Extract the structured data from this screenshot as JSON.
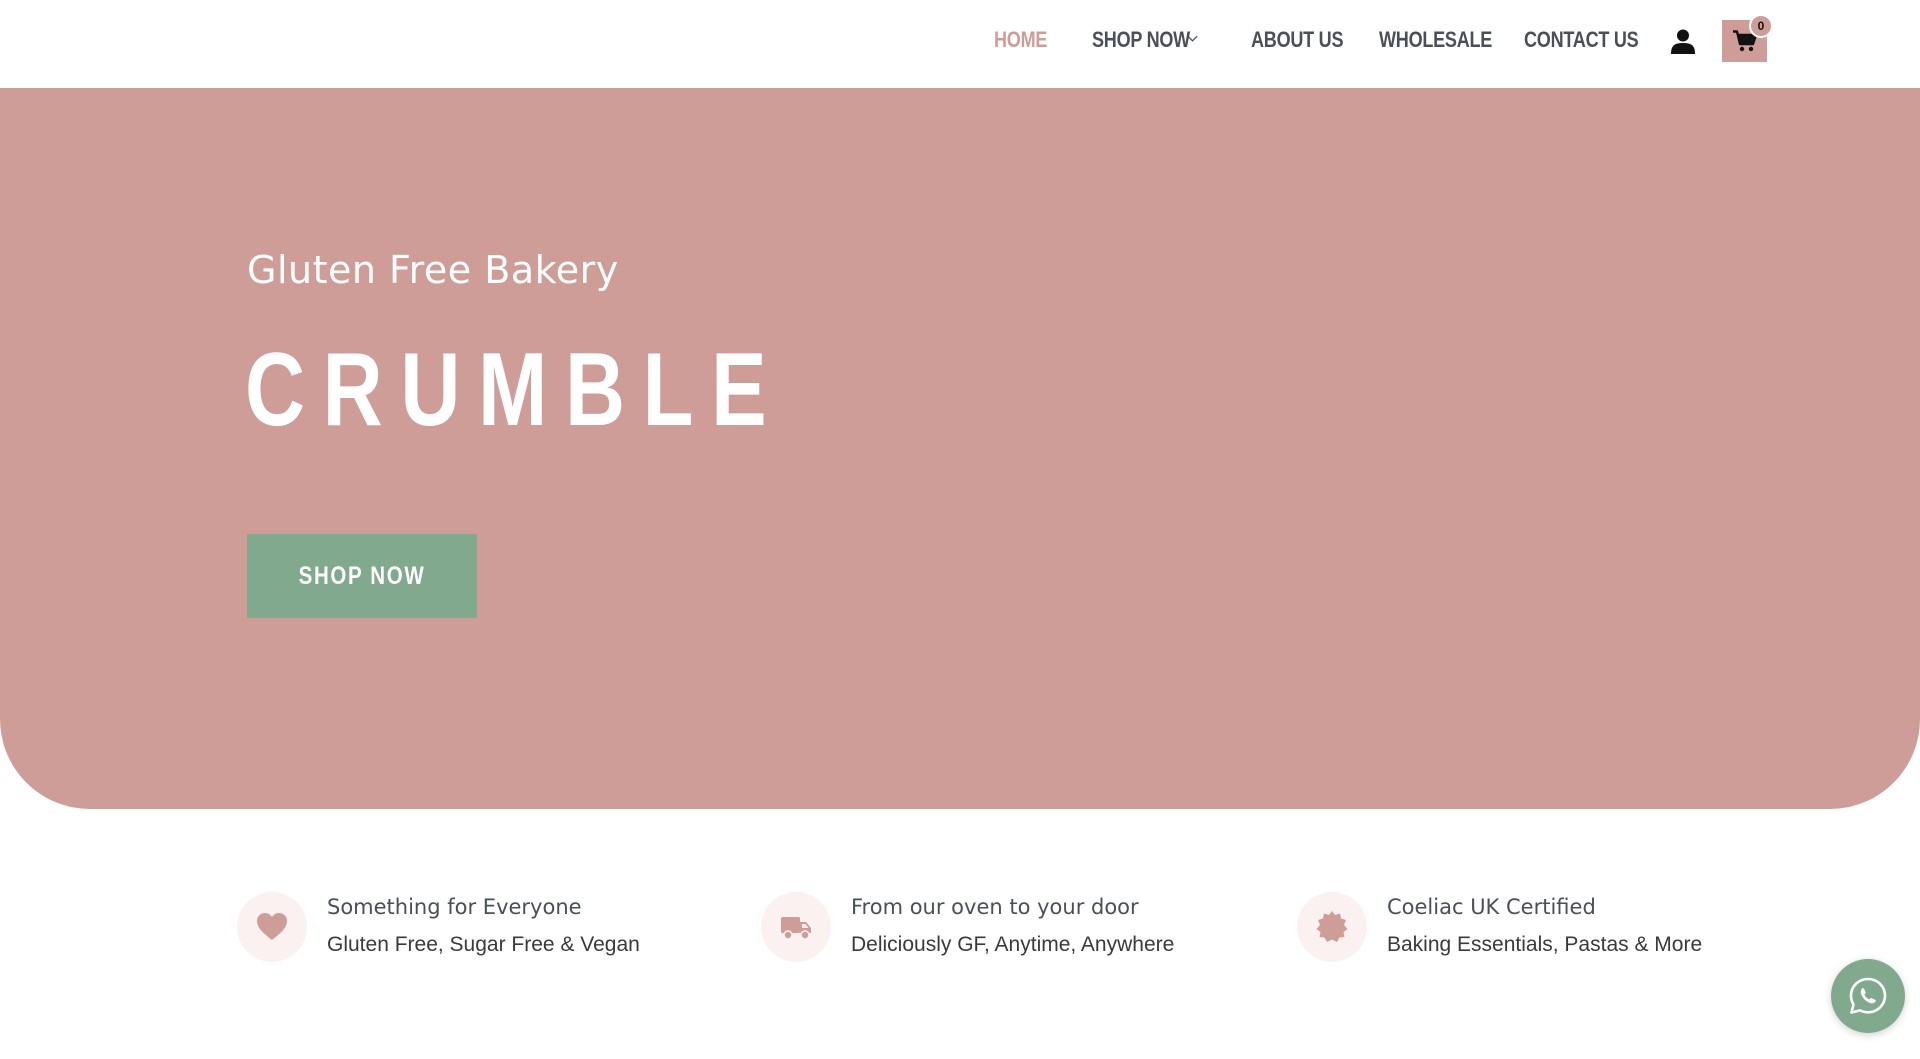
{
  "nav": {
    "items": [
      {
        "label": "HOME",
        "active": true
      },
      {
        "label": "SHOP NOW",
        "active": false,
        "dropdown": true
      },
      {
        "label": "ABOUT US",
        "active": false
      },
      {
        "label": "WHOLESALE",
        "active": false
      },
      {
        "label": "CONTACT US",
        "active": false
      }
    ],
    "icons": [
      "chevron-down-icon",
      "user-icon",
      "cart-icon"
    ],
    "cart_count": "0"
  },
  "hero": {
    "subtitle": "Gluten Free Bakery",
    "title": "CRUMBLE",
    "button_label": "SHOP NOW"
  },
  "features": [
    {
      "icon": "heart-icon",
      "title": "Something for Everyone",
      "description": "Gluten Free, Sugar Free & Vegan"
    },
    {
      "icon": "truck-icon",
      "title": "From our oven to your door",
      "description": "Deliciously GF, Anytime, Anywhere"
    },
    {
      "icon": "badge-icon",
      "title": "Coeliac UK Certified",
      "description": "Baking Essentials, Pastas & More"
    }
  ],
  "whatsapp": {
    "icon": "whatsapp-icon"
  },
  "colors": {
    "brand_pink": "#cf9d97",
    "brand_green": "#81a98d",
    "nav_text": "#4b4f58",
    "icon_circle_bg": "#fbf1f0"
  }
}
